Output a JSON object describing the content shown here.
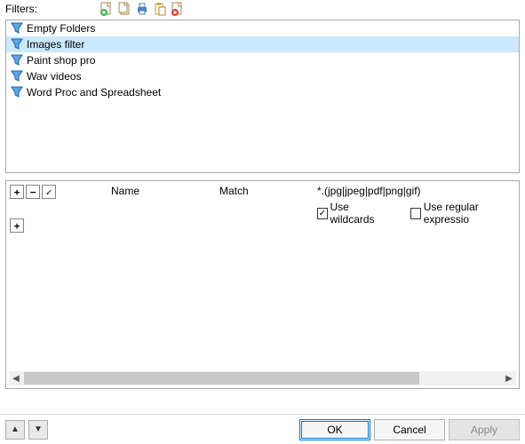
{
  "toolbar": {
    "label": "Filters:"
  },
  "filters": {
    "items": [
      {
        "label": "Empty Folders",
        "selected": false
      },
      {
        "label": "Images filter",
        "selected": true
      },
      {
        "label": "Paint shop pro",
        "selected": false
      },
      {
        "label": "Wav videos",
        "selected": false
      },
      {
        "label": "Word Proc and Spreadsheet",
        "selected": false
      }
    ]
  },
  "detail": {
    "columns": {
      "name": "Name",
      "match": "Match"
    },
    "pattern": "*.(jpg|jpeg|pdf|png|gif)",
    "wildcards_label": "Use wildcards",
    "regex_label": "Use regular expressio",
    "wildcards_checked": true,
    "regex_checked": false,
    "buttons": {
      "plus": "+",
      "minus": "−",
      "check": "✓"
    }
  },
  "footer": {
    "ok": "OK",
    "cancel": "Cancel",
    "apply": "Apply"
  }
}
